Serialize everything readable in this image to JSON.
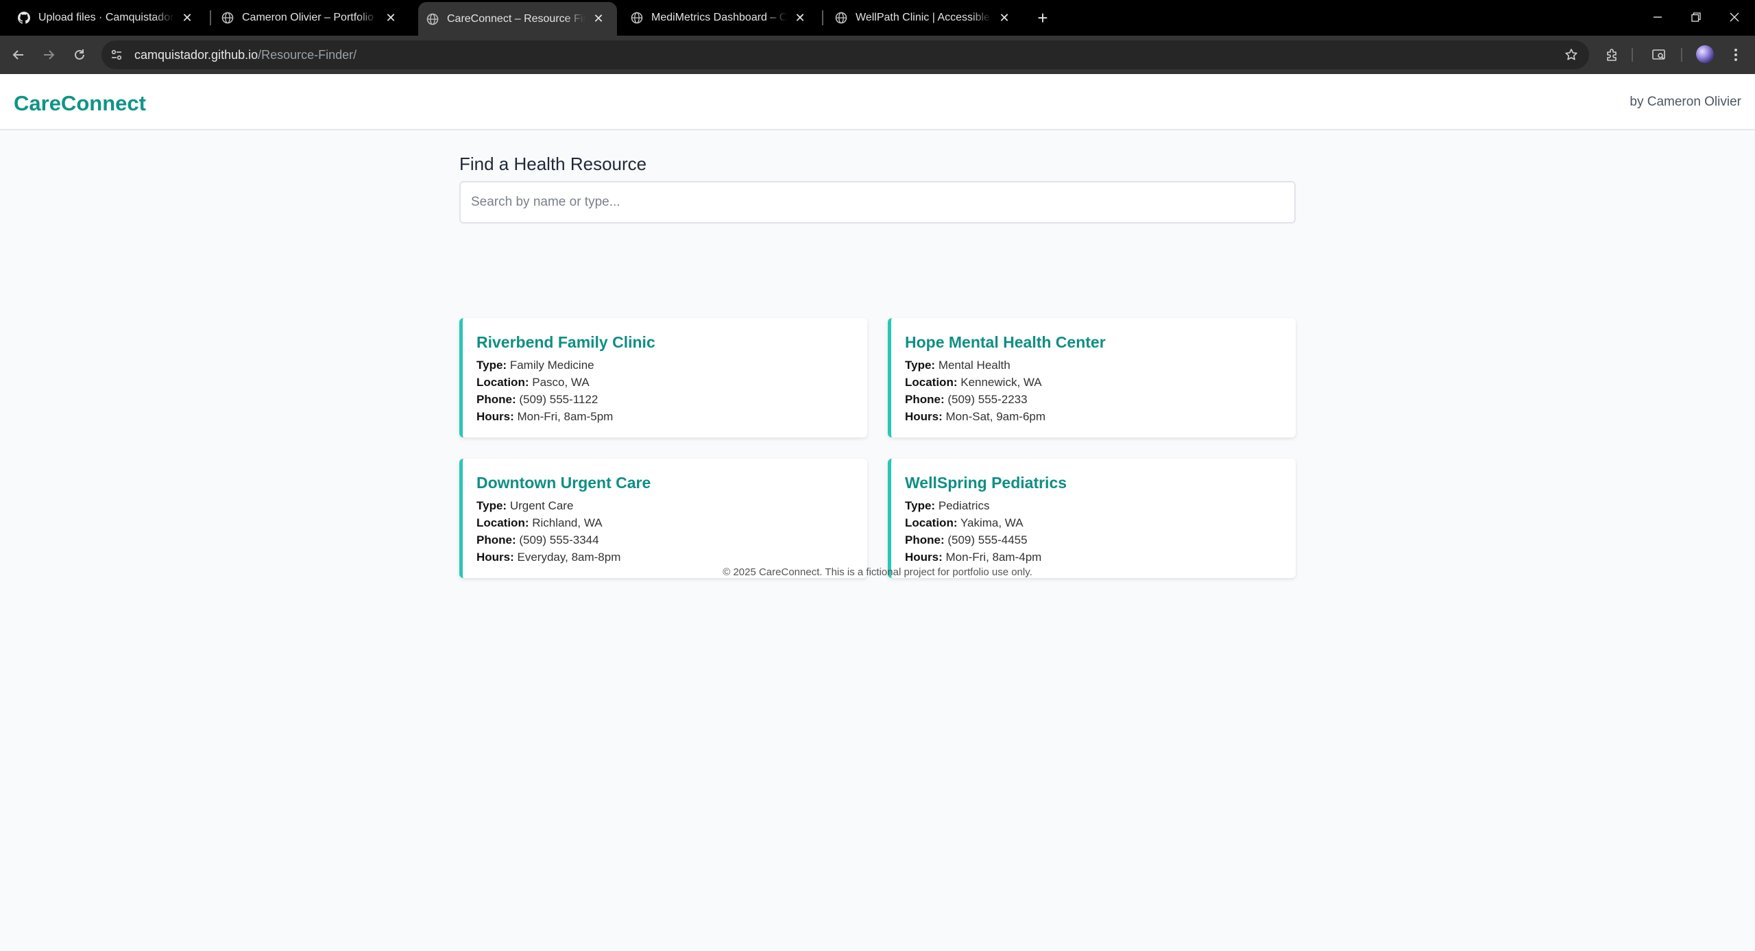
{
  "browser": {
    "tabs": [
      {
        "title": "Upload files · Camquistador/careconnect",
        "icon": "github-icon",
        "active": false
      },
      {
        "title": "Cameron Olivier – Portfolio",
        "icon": "globe-icon",
        "active": false
      },
      {
        "title": "CareConnect – Resource Finder",
        "icon": "globe-icon",
        "active": true
      },
      {
        "title": "MediMetrics Dashboard – Cameron Olivier",
        "icon": "globe-icon",
        "active": false
      },
      {
        "title": "WellPath Clinic | Accessible Health",
        "icon": "globe-icon",
        "active": false
      }
    ],
    "url_host": "camquistador.github.io",
    "url_path": "/Resource-Finder/"
  },
  "site": {
    "brand": "CareConnect",
    "byline": "by Cameron Olivier",
    "brand_color": "#0f9488"
  },
  "main": {
    "heading": "Find a Health Resource",
    "search_placeholder": "Search by name or type..."
  },
  "labels": {
    "type": "Type:",
    "location": "Location:",
    "phone": "Phone:",
    "hours": "Hours:"
  },
  "resources": [
    {
      "name": "Riverbend Family Clinic",
      "type": "Family Medicine",
      "location": "Pasco, WA",
      "phone": "(509) 555-1122",
      "hours": "Mon-Fri, 8am-5pm"
    },
    {
      "name": "Hope Mental Health Center",
      "type": "Mental Health",
      "location": "Kennewick, WA",
      "phone": "(509) 555-2233",
      "hours": "Mon-Sat, 9am-6pm"
    },
    {
      "name": "Downtown Urgent Care",
      "type": "Urgent Care",
      "location": "Richland, WA",
      "phone": "(509) 555-3344",
      "hours": "Everyday, 8am-8pm"
    },
    {
      "name": "WellSpring Pediatrics",
      "type": "Pediatrics",
      "location": "Yakima, WA",
      "phone": "(509) 555-4455",
      "hours": "Mon-Fri, 8am-4pm"
    }
  ],
  "footer": "© 2025 CareConnect. This is a fictional project for portfolio use only."
}
